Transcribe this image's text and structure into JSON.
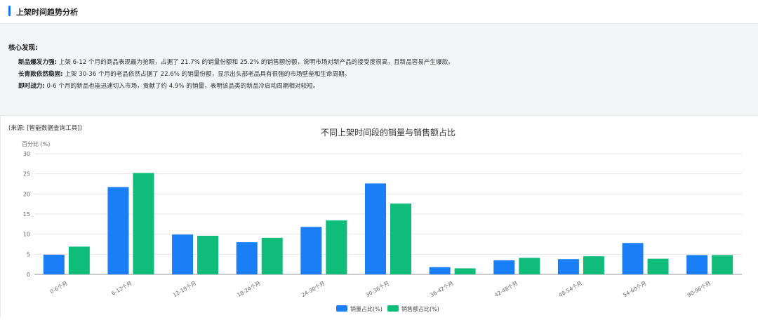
{
  "section": {
    "title": "上架时间趋势分析"
  },
  "insights": {
    "heading": "核心发现:",
    "items": [
      {
        "label": "新品爆发力强:",
        "text": "上架 6-12 个月的商品表现最为抢眼，占据了 21.7% 的销量份额和 25.2% 的销售额份额，说明市场对新产品的接受度很高，且新品容易产生爆款。"
      },
      {
        "label": "长青款依然稳固:",
        "text": "上架 30-36 个月的老品依然占据了 22.6% 的销量份额，显示出头部老品具有很强的市场壁垒和生命周期。"
      },
      {
        "label": "即时战力:",
        "text": "0-6 个月的新品也能迅速切入市场，贡献了约 4.9% 的销量，表明该品类的新品冷启动周期相对较短。"
      }
    ],
    "source": "(来源: [智能数据查询工具])"
  },
  "chart_data": {
    "type": "bar",
    "title": "不同上架时间段的销量与销售额占比",
    "ylabel": "百分比 (%)",
    "xlabel": "",
    "ylim": [
      0,
      30
    ],
    "yticks": [
      0,
      5,
      10,
      15,
      20,
      25,
      30
    ],
    "categories": [
      "0-6个月",
      "6-12个月",
      "12-18个月",
      "18-24个月",
      "24-30个月",
      "30-36个月",
      "36-42个月",
      "42-48个月",
      "48-54个月",
      "54-60个月",
      "90-96个月"
    ],
    "series": [
      {
        "name": "销量占比(%)",
        "color": "#1a7ff7",
        "values": [
          4.9,
          21.7,
          9.9,
          8.0,
          11.8,
          22.6,
          1.8,
          3.5,
          3.8,
          7.8,
          4.8
        ]
      },
      {
        "name": "销售额占比(%)",
        "color": "#0fbc7a",
        "values": [
          6.9,
          25.2,
          9.6,
          9.1,
          13.4,
          17.6,
          1.5,
          4.1,
          4.5,
          3.9,
          4.8
        ]
      }
    ],
    "grid": true,
    "legend": "bottom-center"
  }
}
